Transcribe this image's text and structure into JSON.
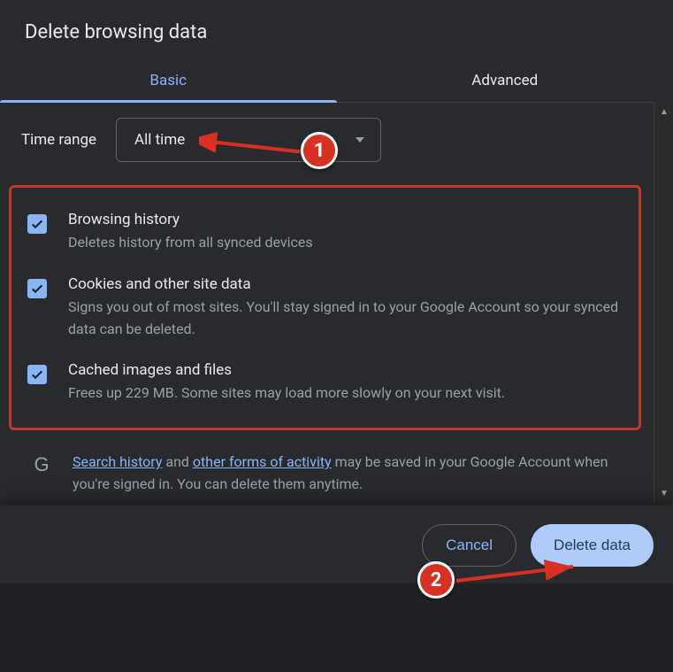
{
  "title": "Delete browsing data",
  "tabs": {
    "basic": "Basic",
    "advanced": "Advanced"
  },
  "time": {
    "label": "Time range",
    "value": "All time"
  },
  "items": [
    {
      "title": "Browsing history",
      "desc": "Deletes history from all synced devices"
    },
    {
      "title": "Cookies and other site data",
      "desc": "Signs you out of most sites. You'll stay signed in to your Google Account so your synced data can be deleted."
    },
    {
      "title": "Cached images and files",
      "desc": "Frees up 229 MB. Some sites may load more slowly on your next visit."
    }
  ],
  "info": {
    "link1": "Search history",
    "mid1": " and ",
    "link2": "other forms of activity",
    "rest": " may be saved in your Google Account when you're signed in. You can delete them anytime."
  },
  "footer": {
    "cancel": "Cancel",
    "confirm": "Delete data"
  },
  "annotations": {
    "m1": "1",
    "m2": "2"
  }
}
